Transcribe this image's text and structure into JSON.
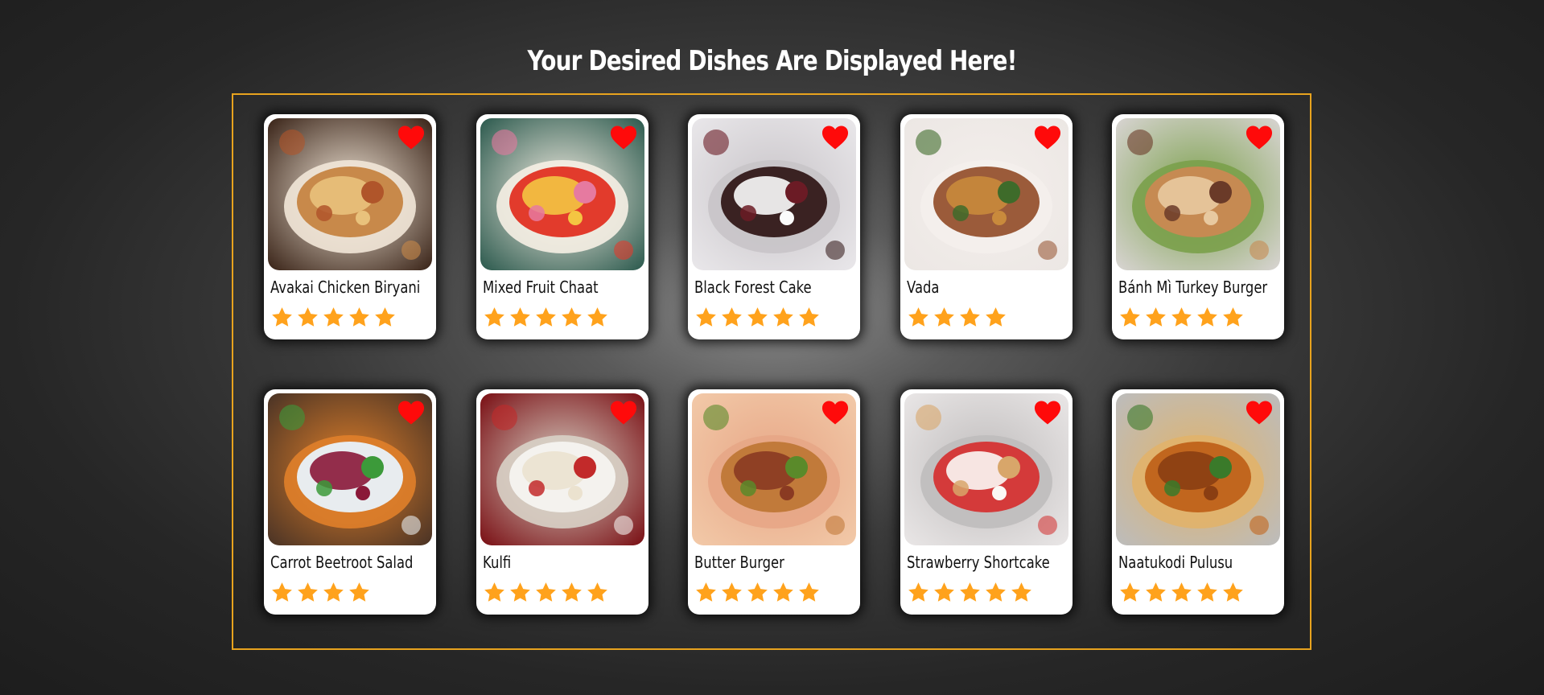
{
  "page": {
    "title": "Your Desired Dishes Are Displayed Here!"
  },
  "colors": {
    "accent_border": "#e8a31e",
    "star": "#ffa21c",
    "heart": "#ff0a0a"
  },
  "dishes": [
    {
      "name": "Avakai Chicken Biryani",
      "rating": 5,
      "image": "biryani-photo",
      "palette": [
        "#3a2418",
        "#c8894a",
        "#e9c27c",
        "#b0552a",
        "#f2e7d8"
      ]
    },
    {
      "name": "Mixed Fruit Chaat",
      "rating": 5,
      "image": "fruit-chaat-photo",
      "palette": [
        "#2c5a4e",
        "#e23b2c",
        "#f4c542",
        "#e67aa0",
        "#f6efe4"
      ]
    },
    {
      "name": "Black Forest Cake",
      "rating": 5,
      "image": "black-forest-cake-photo",
      "palette": [
        "#e9e7ea",
        "#3a2222",
        "#fbfbfb",
        "#6b1b25",
        "#c8c4c8"
      ]
    },
    {
      "name": "Vada",
      "rating": 4,
      "image": "vada-photo",
      "palette": [
        "#ece7e4",
        "#9b5b3a",
        "#c98a3c",
        "#3e6b2a",
        "#f4efec"
      ]
    },
    {
      "name": "Bánh Mì Turkey Burger",
      "rating": 5,
      "image": "banh-mi-burger-photo",
      "palette": [
        "#d8d4d2",
        "#c68a52",
        "#e8c9a0",
        "#6a3a28",
        "#7aa04a"
      ]
    },
    {
      "name": "Carrot Beetroot Salad",
      "rating": 4,
      "image": "carrot-beetroot-salad-photo",
      "palette": [
        "#4a3325",
        "#e8ecef",
        "#8a1838",
        "#3c9a3a",
        "#e0802a"
      ]
    },
    {
      "name": "Kulfi",
      "rating": 5,
      "image": "kulfi-photo",
      "palette": [
        "#7a0f14",
        "#f4f2ee",
        "#ebe2cf",
        "#c22a2a",
        "#d8d2c6"
      ]
    },
    {
      "name": "Butter Burger",
      "rating": 5,
      "image": "butter-burger-photo",
      "palette": [
        "#f2c9a8",
        "#c17a3a",
        "#8a3a22",
        "#5a8a2a",
        "#e7a686"
      ]
    },
    {
      "name": "Strawberry Shortcake",
      "rating": 5,
      "image": "strawberry-shortcake-photo",
      "palette": [
        "#e9e6e6",
        "#d43a3a",
        "#fbf8f5",
        "#d8a66a",
        "#bfbcbc"
      ]
    },
    {
      "name": "Naatukodi Pulusu",
      "rating": 5,
      "image": "naatukodi-pulusu-photo",
      "palette": [
        "#bcbcbc",
        "#c1661e",
        "#8a3e12",
        "#3a7a2a",
        "#e1b36a"
      ]
    }
  ]
}
